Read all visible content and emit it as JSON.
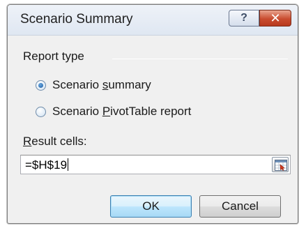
{
  "window": {
    "title": "Scenario Summary",
    "help_label": "?",
    "close_label": "✕"
  },
  "report_type": {
    "label": "Report type",
    "options": [
      {
        "label_before": "Scenario ",
        "mnemonic": "s",
        "label_after": "ummary",
        "selected": true
      },
      {
        "label_before": "Scenario ",
        "mnemonic": "P",
        "label_after": "ivotTable report",
        "selected": false
      }
    ]
  },
  "result_cells": {
    "label_mnemonic": "R",
    "label_rest": "esult cells:",
    "value": "=$H$19",
    "collapse_icon": "range-selector-icon"
  },
  "buttons": {
    "ok": "OK",
    "cancel": "Cancel"
  }
}
